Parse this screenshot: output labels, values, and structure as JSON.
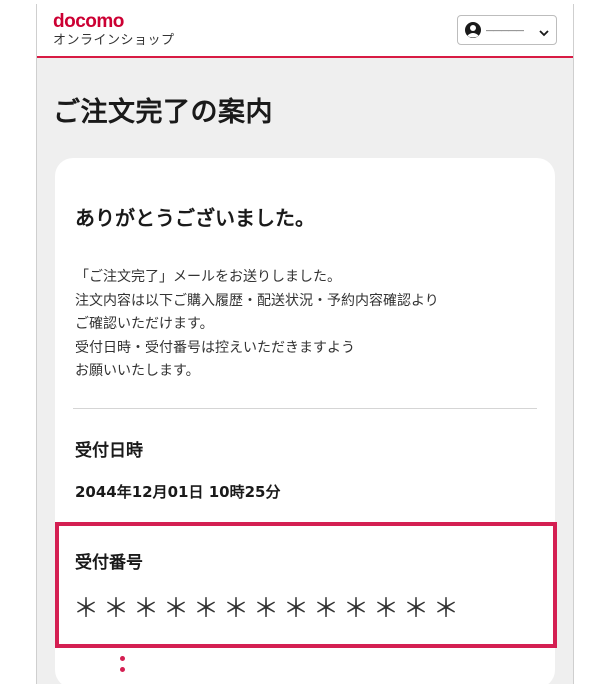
{
  "header": {
    "logo_main": "docomo",
    "logo_sub": "オンラインショップ",
    "account_name": "―――――",
    "account_icon": "user-circle-icon",
    "dropdown_icon": "chevron-down-icon"
  },
  "page": {
    "title": "ご注文完了の案内"
  },
  "card": {
    "thanks": "ありがとうございました。",
    "message_lines": [
      "「ご注文完了」メールをお送りしました。",
      "注文内容は以下ご購入履歴・配送状況・予約内容確認より",
      "ご確認いただけます。",
      "受付日時・受付番号は控えいただきますよう",
      "お願いいたします。"
    ],
    "received_date_label": "受付日時",
    "received_date_value": "2044年12月01日 10時25分",
    "received_number_label": "受付番号",
    "received_number_value": "＊＊＊＊＊＊＊＊＊＊＊＊＊"
  },
  "colors": {
    "brand": "#cc0033",
    "highlight": "#d41f52",
    "background": "#efefef"
  }
}
